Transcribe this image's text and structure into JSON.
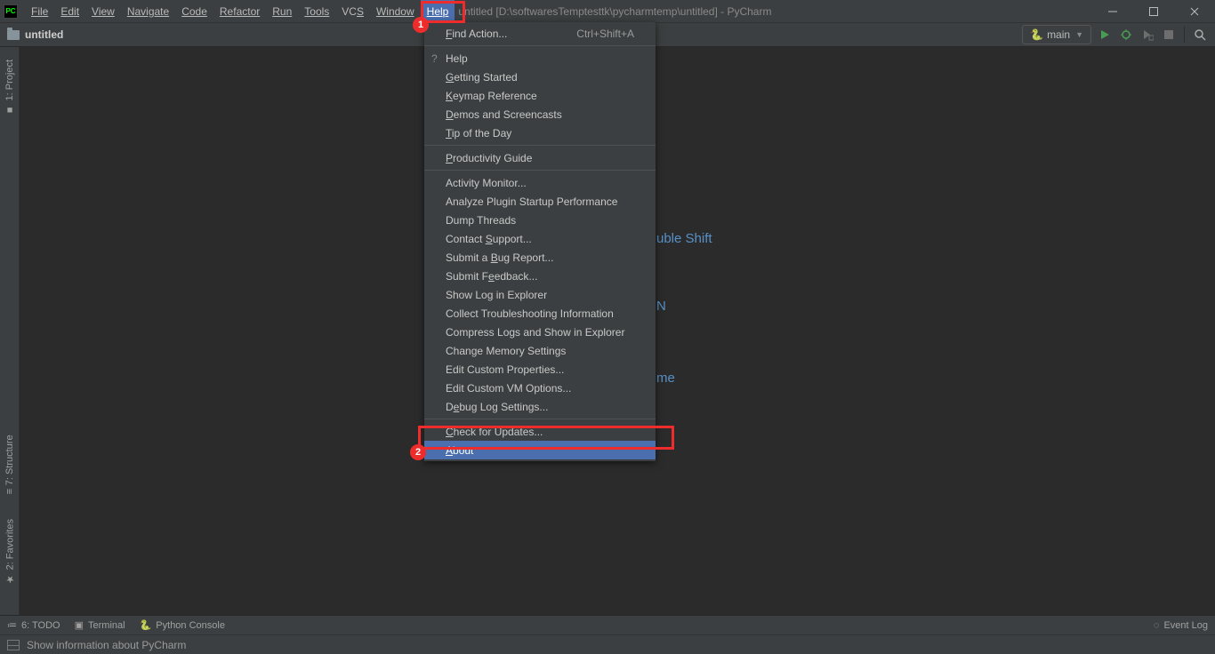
{
  "app": {
    "icon_text": "PC",
    "title_suffix": "untitled [D:\\softwaresTemptesttk\\pycharmtemp\\untitled] - PyCharm"
  },
  "menus": {
    "file": "File",
    "edit": "Edit",
    "view": "View",
    "navigate": "Navigate",
    "code": "Code",
    "refactor": "Refactor",
    "run": "Run",
    "tools": "Tools",
    "vcs": "VCS",
    "window": "Window",
    "help": "Help"
  },
  "breadcrumb": {
    "project": "untitled"
  },
  "run_config": {
    "name": "main",
    "py_icon": "🐍"
  },
  "help_menu": {
    "find_action": "Find Action...",
    "find_action_shortcut": "Ctrl+Shift+A",
    "help": "Help",
    "getting_started": "Getting Started",
    "keymap": "Keymap Reference",
    "demos": "Demos and Screencasts",
    "tip": "Tip of the Day",
    "productivity": "Productivity Guide",
    "activity": "Activity Monitor...",
    "analyze_plugin": "Analyze Plugin Startup Performance",
    "dump_threads": "Dump Threads",
    "contact_support": "Contact Support...",
    "bug_report": "Submit a Bug Report...",
    "feedback": "Submit Feedback...",
    "show_log": "Show Log in Explorer",
    "collect_trouble": "Collect Troubleshooting Information",
    "compress_logs": "Compress Logs and Show in Explorer",
    "memory": "Change Memory Settings",
    "custom_props": "Edit Custom Properties...",
    "custom_vm": "Edit Custom VM Options...",
    "debug_log": "Debug Log Settings...",
    "check_updates": "Check for Updates...",
    "about": "About"
  },
  "editor_hints": {
    "hint1": "uble Shift",
    "hint2": "N",
    "hint3": "me"
  },
  "side_tools": {
    "project": "1: Project",
    "structure": "7: Structure",
    "favorites": "2: Favorites"
  },
  "bottom_tools": {
    "todo": "6: TODO",
    "terminal": "Terminal",
    "python_console": "Python Console",
    "event_log": "Event Log"
  },
  "status": {
    "text": "Show information about PyCharm"
  },
  "annotations": {
    "badge1": "1",
    "badge2": "2"
  }
}
